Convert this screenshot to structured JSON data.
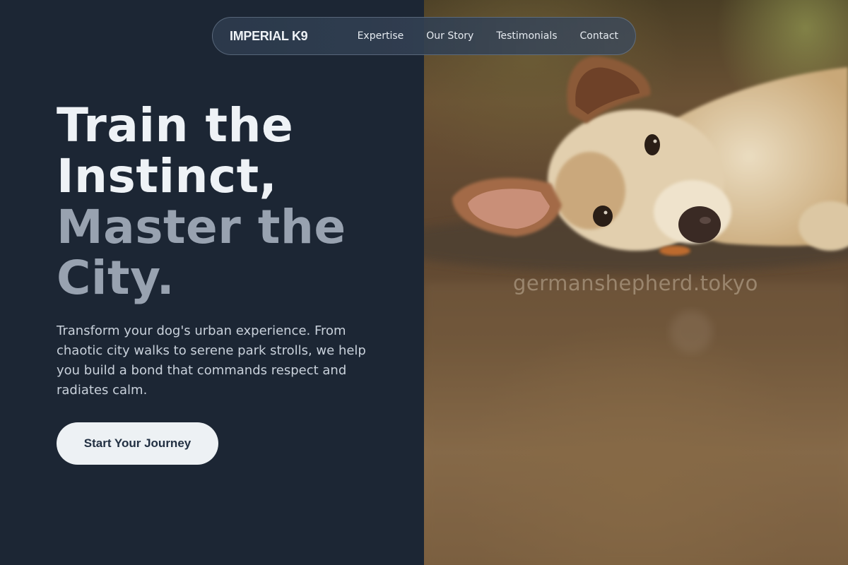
{
  "nav": {
    "brand": "IMPERIAL K9",
    "links": [
      "Expertise",
      "Our Story",
      "Testimonials",
      "Contact"
    ]
  },
  "hero": {
    "headline_lines": [
      "Train the",
      "Instinct,",
      "Master the",
      "City."
    ],
    "subtext": "Transform your dog's urban experience. From chaotic city walks to serene park strolls, we help you build a bond that commands respect and radiates calm.",
    "cta_label": "Start Your Journey"
  },
  "photo": {
    "watermark": "germanshepherd.tokyo"
  },
  "colors": {
    "background": "#1c2634",
    "headline_primary": "#eef2f6",
    "headline_muted": "#98a2b0",
    "cta_background": "#edf1f4",
    "cta_text": "#223042"
  }
}
